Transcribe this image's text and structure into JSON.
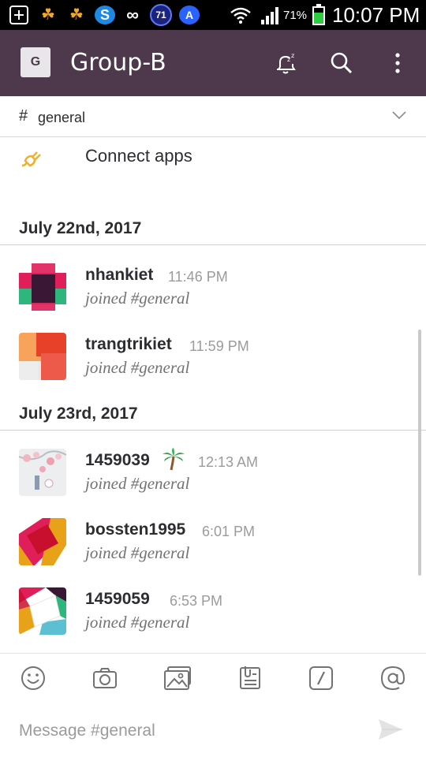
{
  "status_bar": {
    "notif_icons": [
      "plus-square-icon",
      "uc-browser-icon",
      "uc-browser-icon",
      "s-app-icon",
      "infinity-icon",
      "badge-71-icon",
      "shield-a-icon"
    ],
    "badge_count": "71",
    "shield_letter": "A",
    "battery": "71%",
    "time": "10:07 PM"
  },
  "header": {
    "team_initial": "G",
    "team_name": "Group-B",
    "icons": [
      "snooze-bell-icon",
      "search-icon",
      "more-vert-icon"
    ]
  },
  "channel": {
    "hash": "#",
    "name": "general"
  },
  "connect_apps": {
    "label": "Connect apps",
    "icon": "plug-icon"
  },
  "sections": [
    {
      "date": "July 22nd, 2017",
      "messages": [
        {
          "user": "nhankiet",
          "time": "11:46 PM",
          "text": "joined #general"
        },
        {
          "user": "trangtrikiet",
          "time": "11:59 PM",
          "text": "joined #general"
        }
      ]
    },
    {
      "date": "July 23rd, 2017",
      "messages": [
        {
          "user": "1459039",
          "time": "12:13 AM",
          "text": "joined #general",
          "emoji": "palm-tree-icon"
        },
        {
          "user": "bossten1995",
          "time": "6:01 PM",
          "text": "joined #general"
        },
        {
          "user": "1459059",
          "time": "6:53 PM",
          "text": "joined #general"
        }
      ]
    }
  ],
  "toolbar": {
    "icons": [
      "emoji-icon",
      "camera-icon",
      "gallery-icon",
      "file-icon",
      "slash-command-icon",
      "mention-icon"
    ]
  },
  "composer": {
    "placeholder": "Message #general",
    "value": ""
  },
  "colors": {
    "header_bg": "#4d394b",
    "accent_yellow": "#ecb22e"
  }
}
